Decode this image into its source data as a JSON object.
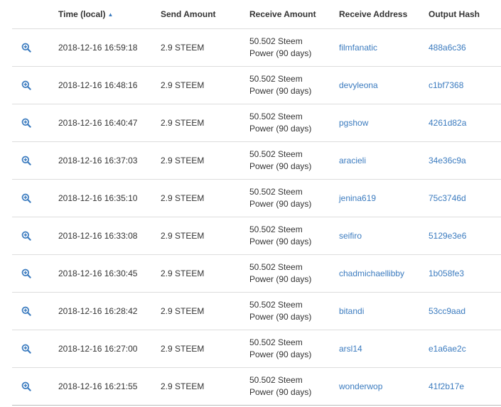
{
  "table": {
    "headers": {
      "time": "Time (local)",
      "time_sort_indicator": "▲",
      "send": "Send Amount",
      "receive": "Receive Amount",
      "address": "Receive Address",
      "hash": "Output Hash"
    },
    "row_icon": "zoom-in-icon",
    "rows": [
      {
        "time": "2018-12-16 16:59:18",
        "send": "2.9 STEEM",
        "receive": "50.502 Steem Power (90 days)",
        "address": "filmfanatic",
        "hash": "488a6c36"
      },
      {
        "time": "2018-12-16 16:48:16",
        "send": "2.9 STEEM",
        "receive": "50.502 Steem Power (90 days)",
        "address": "devyleona",
        "hash": "c1bf7368"
      },
      {
        "time": "2018-12-16 16:40:47",
        "send": "2.9 STEEM",
        "receive": "50.502 Steem Power (90 days)",
        "address": "pgshow",
        "hash": "4261d82a"
      },
      {
        "time": "2018-12-16 16:37:03",
        "send": "2.9 STEEM",
        "receive": "50.502 Steem Power (90 days)",
        "address": "aracieli",
        "hash": "34e36c9a"
      },
      {
        "time": "2018-12-16 16:35:10",
        "send": "2.9 STEEM",
        "receive": "50.502 Steem Power (90 days)",
        "address": "jenina619",
        "hash": "75c3746d"
      },
      {
        "time": "2018-12-16 16:33:08",
        "send": "2.9 STEEM",
        "receive": "50.502 Steem Power (90 days)",
        "address": "seifiro",
        "hash": "5129e3e6"
      },
      {
        "time": "2018-12-16 16:30:45",
        "send": "2.9 STEEM",
        "receive": "50.502 Steem Power (90 days)",
        "address": "chadmichaellibby",
        "hash": "1b058fe3"
      },
      {
        "time": "2018-12-16 16:28:42",
        "send": "2.9 STEEM",
        "receive": "50.502 Steem Power (90 days)",
        "address": "bitandi",
        "hash": "53cc9aad"
      },
      {
        "time": "2018-12-16 16:27:00",
        "send": "2.9 STEEM",
        "receive": "50.502 Steem Power (90 days)",
        "address": "arsl14",
        "hash": "e1a6ae2c"
      },
      {
        "time": "2018-12-16 16:21:55",
        "send": "2.9 STEEM",
        "receive": "50.502 Steem Power (90 days)",
        "address": "wonderwop",
        "hash": "41f2b17e"
      }
    ]
  },
  "colors": {
    "link": "#3b7bbf",
    "border": "#dddddd",
    "text": "#333333"
  }
}
